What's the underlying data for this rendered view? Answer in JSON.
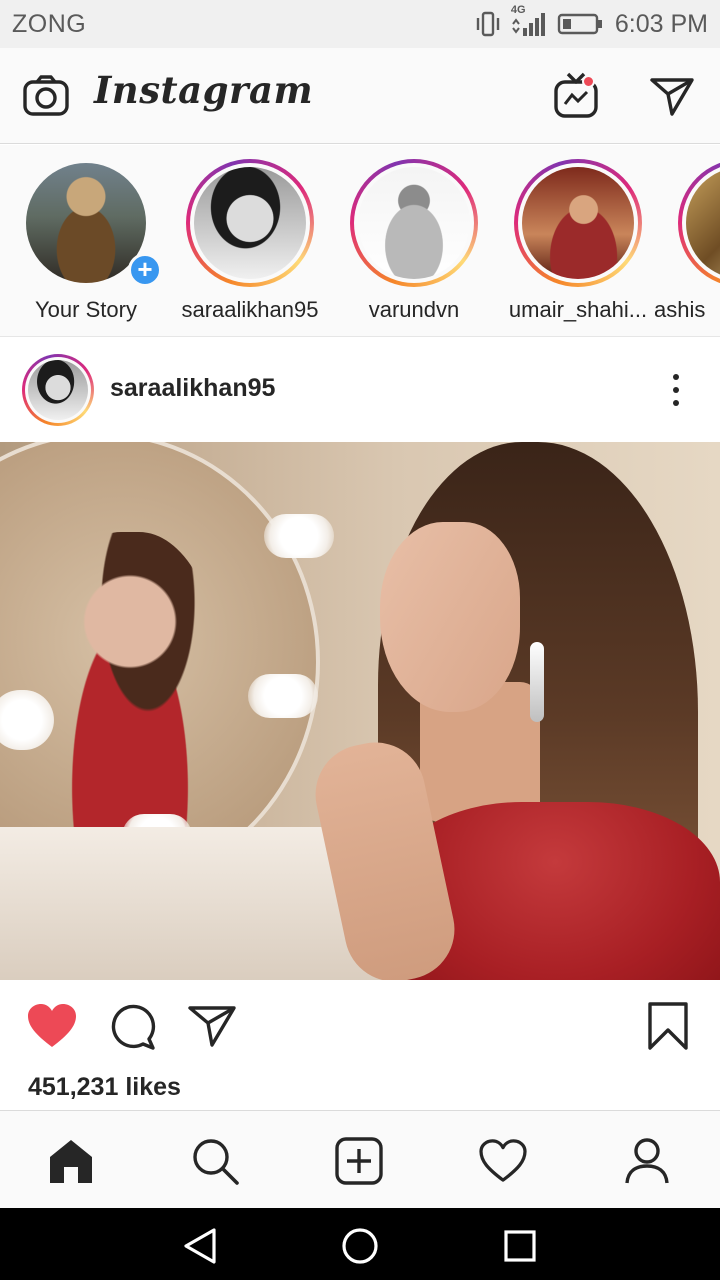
{
  "status_bar": {
    "carrier": "ZONG",
    "network_badge": "4G",
    "time": "6:03 PM",
    "icons": [
      "vibrate-icon",
      "signal-icon",
      "battery-icon"
    ]
  },
  "header": {
    "logo_text": "Instagram",
    "icons": [
      "camera-icon",
      "igtv-icon",
      "direct-message-icon"
    ],
    "notification_color": "#ed4956"
  },
  "stories": [
    {
      "name": "Your Story",
      "has_ring": false,
      "add_badge": "+"
    },
    {
      "name": "saraalikhan95",
      "has_ring": true
    },
    {
      "name": "varundvn",
      "has_ring": true
    },
    {
      "name": "umair_shahi...",
      "has_ring": true
    },
    {
      "name": "ashis",
      "has_ring": true
    }
  ],
  "post": {
    "username": "saraalikhan95",
    "likes": "451,231 likes",
    "liked": true,
    "like_color": "#ed4956"
  },
  "bottom_nav": {
    "items": [
      "home-icon",
      "search-icon",
      "new-post-icon",
      "activity-heart-icon",
      "profile-icon"
    ]
  },
  "system_nav": {
    "buttons": [
      "back-icon",
      "home-circle-icon",
      "recents-square-icon"
    ]
  },
  "colors": {
    "story_ring_gradient": [
      "#f58529",
      "#dd2a7b",
      "#8134af"
    ],
    "add_badge": "#3897f0",
    "text": "#262626"
  }
}
